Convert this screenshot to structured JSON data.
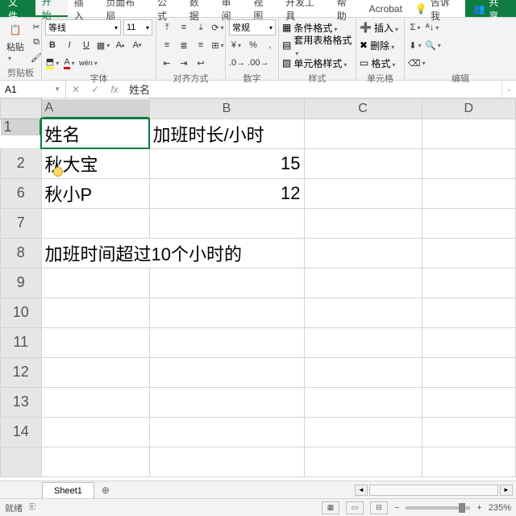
{
  "tabs": {
    "file": "文件",
    "items": [
      "开始",
      "插入",
      "页面布局",
      "公式",
      "数据",
      "审阅",
      "视图",
      "开发工具",
      "帮助",
      "Acrobat"
    ],
    "active": "开始",
    "tell": "告诉我",
    "share": "共享"
  },
  "ribbon": {
    "clipboard": {
      "paste": "粘贴",
      "label": "剪贴板"
    },
    "font": {
      "name": "等线",
      "size": "11",
      "label": "字体"
    },
    "align": {
      "label": "对齐方式"
    },
    "number": {
      "format": "常规",
      "label": "数字"
    },
    "styles": {
      "cond": "条件格式",
      "tbl": "套用表格格式",
      "cell": "单元格样式",
      "label": "样式"
    },
    "cells": {
      "ins": "插入",
      "del": "删除",
      "fmt": "格式",
      "label": "单元格"
    },
    "editing": {
      "label": "编辑"
    }
  },
  "namebox": "A1",
  "formula": "姓名",
  "sheet": {
    "cols": [
      "A",
      "B",
      "C",
      "D"
    ],
    "rows": [
      "1",
      "2",
      "6",
      "7",
      "8",
      "9",
      "10",
      "11",
      "12",
      "13",
      "14"
    ],
    "active": "A1",
    "cells": {
      "A1": "姓名",
      "B1": "加班时长/小时",
      "A2": "秋大宝",
      "B2": "15",
      "A6": "秋小P",
      "B6": "12",
      "A8": "加班时间超过10个小时的"
    }
  },
  "sheettabs": {
    "active": "Sheet1"
  },
  "status": {
    "ready": "就绪",
    "acc": "",
    "zoom": "235%"
  }
}
